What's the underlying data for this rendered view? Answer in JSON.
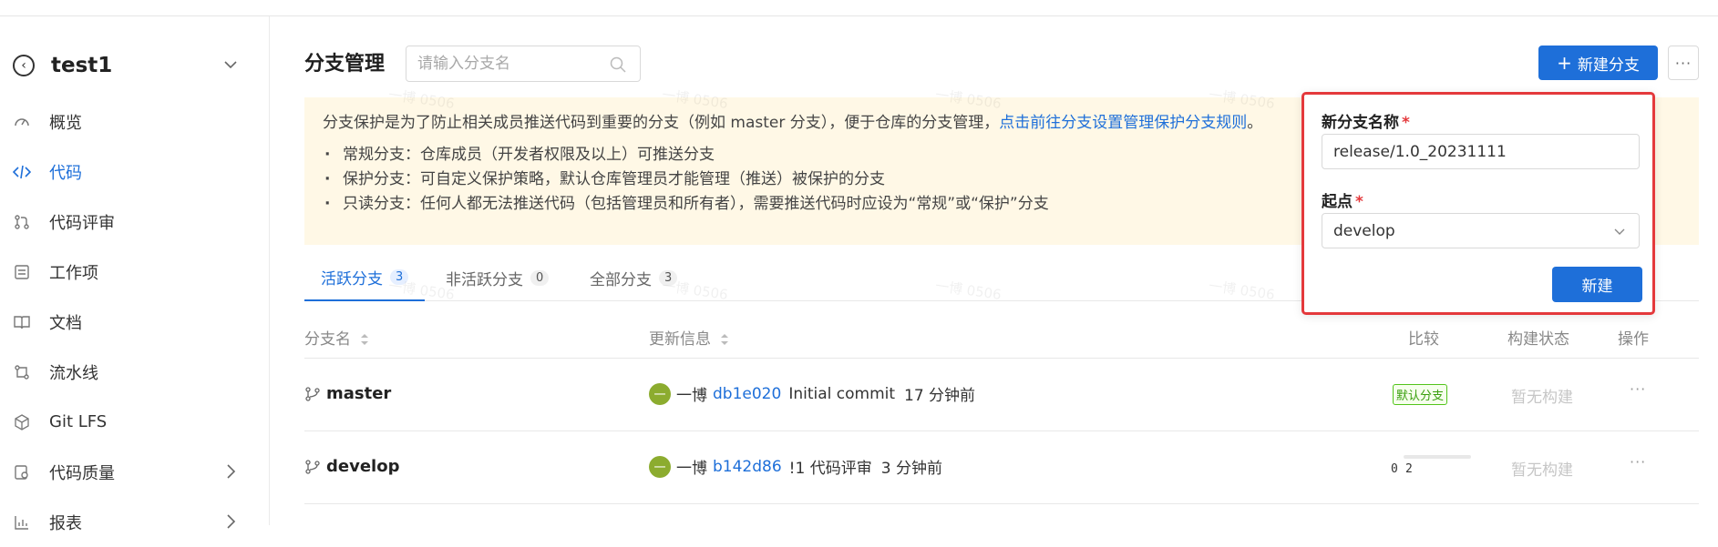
{
  "project": {
    "name": "test1"
  },
  "sidebar": {
    "items": [
      {
        "label": "概览",
        "icon": "dashboard-icon",
        "active": false
      },
      {
        "label": "代码",
        "icon": "code-icon",
        "active": true
      },
      {
        "label": "代码评审",
        "icon": "merge-request-icon",
        "active": false
      },
      {
        "label": "工作项",
        "icon": "task-list-icon",
        "active": false
      },
      {
        "label": "文档",
        "icon": "book-icon",
        "active": false
      },
      {
        "label": "流水线",
        "icon": "pipeline-icon",
        "active": false
      },
      {
        "label": "Git LFS",
        "icon": "cube-icon",
        "active": false
      },
      {
        "label": "代码质量",
        "icon": "quality-icon",
        "active": false
      },
      {
        "label": "报表",
        "icon": "chart-icon",
        "active": false
      }
    ]
  },
  "header": {
    "title": "分支管理",
    "search_placeholder": "请输入分支名",
    "new_branch_label": "新建分支",
    "more_label": "···"
  },
  "notice": {
    "text": "分支保护是为了防止相关成员推送代码到重要的分支（例如 master 分支），便于仓库的分支管理，",
    "link": "点击前往分支设置管理保护分支规则",
    "end": "。",
    "items": [
      "常规分支：仓库成员（开发者权限及以上）可推送分支",
      "保护分支：可自定义保护策略，默认仓库管理员才能管理（推送）被保护的分支",
      "只读分支：任何人都无法推送代码（包括管理员和所有者），需要推送代码时应设为“常规”或“保护”分支"
    ]
  },
  "tabs": [
    {
      "label": "活跃分支",
      "count": "3",
      "active": true
    },
    {
      "label": "非活跃分支",
      "count": "0",
      "active": false
    },
    {
      "label": "全部分支",
      "count": "3",
      "active": false
    }
  ],
  "table": {
    "columns": [
      "分支名",
      "更新信息",
      "比较",
      "构建状态",
      "操作"
    ],
    "rows": [
      {
        "name": "master",
        "author": "一博",
        "avatar": "一",
        "commit": "db1e020",
        "message": "Initial commit",
        "time": "17 分钟前",
        "badge": "默认分支",
        "build": "暂无构建",
        "actions": "···"
      },
      {
        "name": "develop",
        "author": "一博",
        "avatar": "一",
        "commit": "b142d86",
        "message": "!1 代码评审",
        "time": "3 分钟前",
        "behind": "0",
        "ahead": "2",
        "build": "暂无构建",
        "actions": "···"
      }
    ]
  },
  "popup": {
    "name_label": "新分支名称",
    "required": "*",
    "name_value": "release/1.0_20231111",
    "origin_label": "起点",
    "origin_value": "develop",
    "submit_label": "新建"
  },
  "watermark": "一博 0506",
  "colors": {
    "primary": "#1e6fd9",
    "highlight": "#e4393c",
    "notice_bg": "#fff8e6",
    "avatar": "#8cac2f"
  }
}
